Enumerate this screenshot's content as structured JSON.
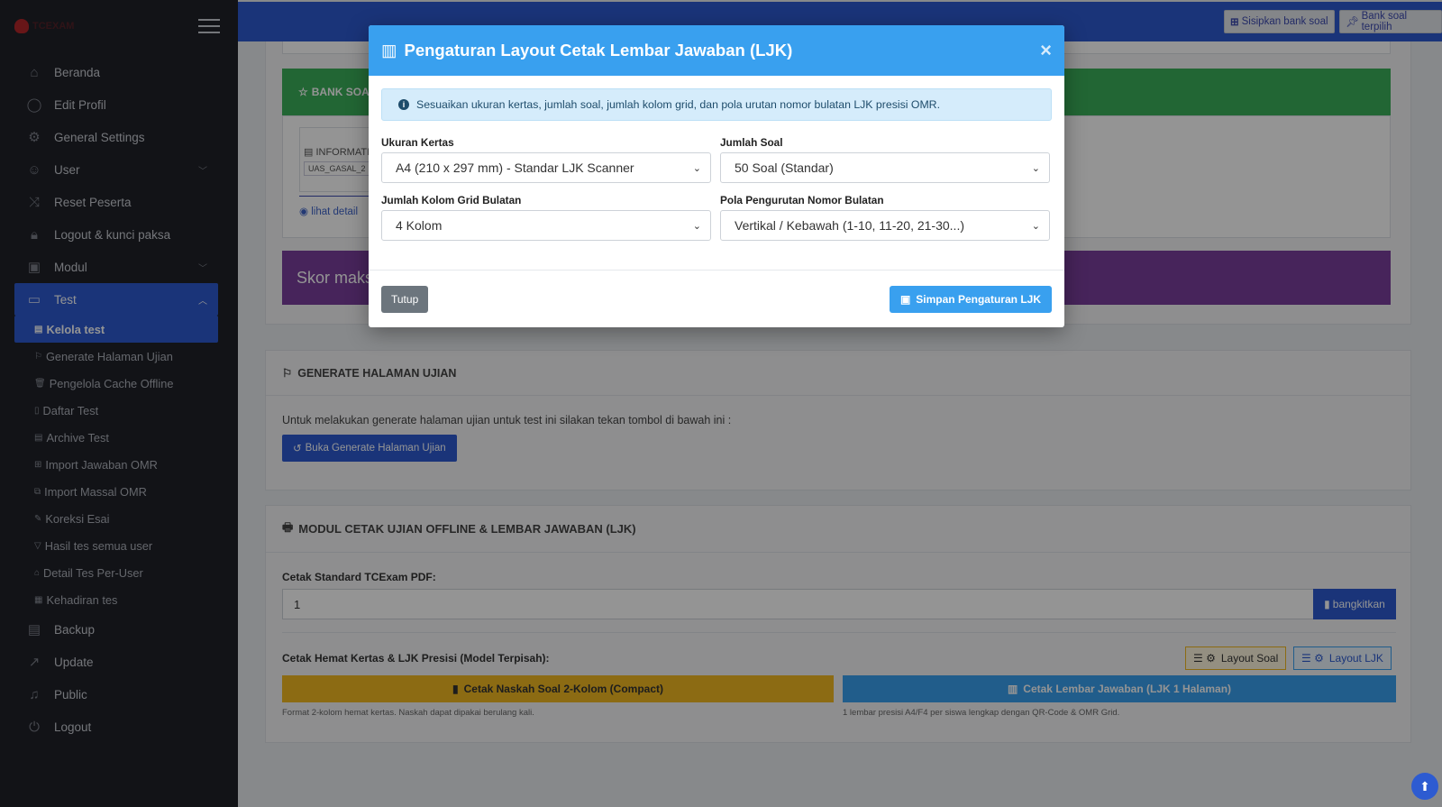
{
  "sidebar": {
    "logo_text": "TCEXAM",
    "menu": [
      {
        "label": "Beranda",
        "icon": "home-icon"
      },
      {
        "label": "Edit Profil",
        "icon": "user-circle-icon"
      },
      {
        "label": "General Settings",
        "icon": "gear-icon"
      },
      {
        "label": "User",
        "icon": "users-icon"
      },
      {
        "label": "Reset Peserta",
        "icon": "shuffle-icon"
      },
      {
        "label": "Logout & kunci paksa",
        "icon": "lock-icon"
      },
      {
        "label": "Modul",
        "icon": "image-icon"
      },
      {
        "label": "Test",
        "icon": "monitor-icon"
      }
    ],
    "submenu": [
      {
        "label": "Kelola test"
      },
      {
        "label": "Generate Halaman Ujian"
      },
      {
        "label": "Pengelola Cache Offline"
      },
      {
        "label": "Daftar Test"
      },
      {
        "label": "Archive Test"
      },
      {
        "label": "Import Jawaban OMR"
      },
      {
        "label": "Import Massal OMR"
      },
      {
        "label": "Koreksi Esai"
      },
      {
        "label": "Hasil tes semua user"
      },
      {
        "label": "Detail Tes Per-User"
      },
      {
        "label": "Kehadiran tes"
      }
    ],
    "menu_bottom": [
      {
        "label": "Backup",
        "icon": "archive-icon"
      },
      {
        "label": "Update",
        "icon": "chart-line-icon"
      },
      {
        "label": "Public",
        "icon": "bell-icon"
      },
      {
        "label": "Logout",
        "icon": "power-icon"
      }
    ]
  },
  "topbar": {
    "btn_sisipkan": "Sisipkan bank soal",
    "btn_bank_terpilih": "Bank soal terpilih"
  },
  "content": {
    "bank_soal_title": "BANK SOAL",
    "informasi_label": "INFORMATI",
    "uas_tag": "UAS_GASAL_2",
    "lihat_detail": "lihat detail",
    "skor_maks": "Skor maks",
    "generate_title": "GENERATE HALAMAN UJIAN",
    "generate_text": "Untuk melakukan generate halaman ujian untuk test ini silakan tekan tombol di bawah ini :",
    "generate_btn": "Buka Generate Halaman Ujian",
    "cetak_title": "MODUL CETAK UJIAN OFFLINE & LEMBAR JAWABAN (LJK)",
    "cetak_standard_label": "Cetak Standard TCExam PDF:",
    "cetak_standard_value": "1",
    "bangkitkan": "bangkitkan",
    "hemat_label": "Cetak Hemat Kertas & LJK Presisi (Model Terpisah):",
    "layout_soal": "Layout Soal",
    "layout_ljk": "Layout LJK",
    "cetak_naskah": "Cetak Naskah Soal 2-Kolom (Compact)",
    "cetak_ljk": "Cetak Lembar Jawaban (LJK 1 Halaman)",
    "naskah_note": "Format 2-kolom hemat kertas. Naskah dapat dipakai berulang kali.",
    "ljk_note": "1 lembar presisi A4/F4 per siswa lengkap dengan QR-Code & OMR Grid."
  },
  "modal": {
    "title": "Pengaturan Layout Cetak Lembar Jawaban (LJK)",
    "close": "×",
    "alert": "Sesuaikan ukuran kertas, jumlah soal, jumlah kolom grid, dan pola urutan nomor bulatan LJK presisi OMR.",
    "ukuran_label": "Ukuran Kertas",
    "ukuran_value": "A4 (210 x 297 mm) - Standar LJK Scanner",
    "jumlah_soal_label": "Jumlah Soal",
    "jumlah_soal_value": "50 Soal (Standar)",
    "kolom_label": "Jumlah Kolom Grid Bulatan",
    "kolom_value": "4 Kolom",
    "pola_label": "Pola Pengurutan Nomor Bulatan",
    "pola_value": "Vertikal / Kebawah (1-10, 11-20, 21-30...)",
    "tutup": "Tutup",
    "simpan": "Simpan Pengaturan LJK"
  },
  "colors": {
    "primary": "#2d5bd1",
    "modal_header": "#39a0ef",
    "success": "#3cb05a",
    "purple": "#7a3f9e",
    "warning": "#f2b922"
  }
}
